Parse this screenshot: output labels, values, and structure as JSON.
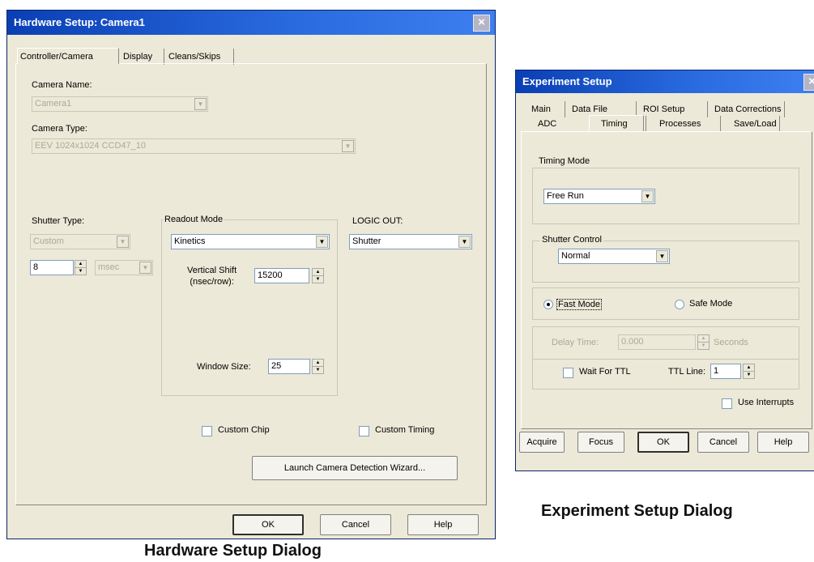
{
  "hardware": {
    "title": "Hardware Setup: Camera1",
    "close_glyph": "×",
    "tabs": [
      "Controller/Camera",
      "Display",
      "Cleans/Skips"
    ],
    "camera_name_label": "Camera Name:",
    "camera_name_value": "Camera1",
    "camera_type_label": "Camera Type:",
    "camera_type_value": "EEV 1024x1024 CCD47_10",
    "shutter_type_label": "Shutter Type:",
    "shutter_type_value": "Custom",
    "shutter_time_value": "8",
    "shutter_unit_value": "msec",
    "readout_mode_label": "Readout Mode",
    "readout_mode_value": "Kinetics",
    "vertical_shift_label_1": "Vertical Shift",
    "vertical_shift_label_2": "(nsec/row):",
    "vertical_shift_value": "15200",
    "window_size_label": "Window Size:",
    "window_size_value": "25",
    "logic_out_label": "LOGIC OUT:",
    "logic_out_value": "Shutter",
    "custom_chip_label": "Custom Chip",
    "custom_timing_label": "Custom Timing",
    "wizard_button": "Launch Camera Detection Wizard...",
    "ok_button": "OK",
    "cancel_button": "Cancel",
    "help_button": "Help",
    "caption": "Hardware Setup Dialog"
  },
  "experiment": {
    "title": "Experiment Setup",
    "close_glyph": "×",
    "tabs_row1": [
      "Main",
      "Data File",
      "ROI Setup",
      "Data Corrections"
    ],
    "tabs_row2": [
      "ADC",
      "Timing",
      "Processes",
      "Save/Load"
    ],
    "timing_mode_label": "Timing Mode",
    "timing_mode_value": "Free Run",
    "shutter_control_label": "Shutter Control",
    "shutter_control_value": "Normal",
    "fast_mode_label": "Fast Mode",
    "safe_mode_label": "Safe Mode",
    "delay_time_label": "Delay Time:",
    "delay_time_value": "0.000",
    "seconds_label": "Seconds",
    "wait_ttl_label": "Wait For TTL",
    "ttl_line_label": "TTL Line:",
    "ttl_line_value": "1",
    "use_interrupts_label": "Use Interrupts",
    "acquire_button": "Acquire",
    "focus_button": "Focus",
    "ok_button": "OK",
    "cancel_button": "Cancel",
    "help_button": "Help",
    "caption": "Experiment Setup Dialog"
  }
}
